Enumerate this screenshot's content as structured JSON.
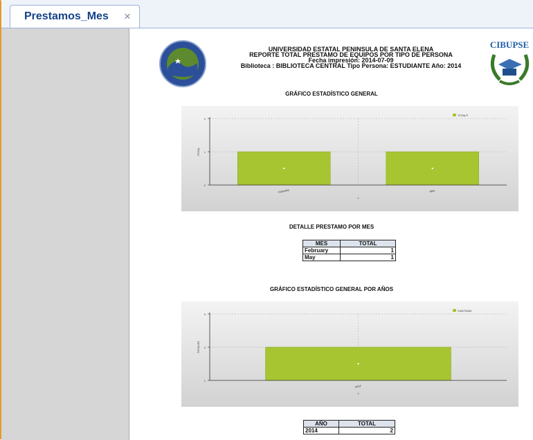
{
  "tab": {
    "label": "Prestamos_Mes",
    "close_glyph": "×",
    "close_icon": "close-icon"
  },
  "report": {
    "logo_right_text": "CIBUPSE",
    "header": {
      "line1": "UNIVERSIDAD ESTATAL PENINSULA DE SANTA ELENA",
      "line2": "REPORTE TOTAL PRESTAMO DE EQUIPOS POR TIPO DE PERSONA",
      "line3": "Fecha impresión: 2014-07-09",
      "line4": "Biblioteca : BIBLIOTECA CENTRAL Tipo Persona: ESTUDIANTE Año: 2014"
    },
    "chart1_title": "GRÁFICO ESTADÍSTICO GENERAL",
    "detail_title": "DETALLE PRESTAMO POR MES",
    "chart2_title": "GRÁFICO ESTADÍSTICO GENERAL POR AÑOS",
    "mes_table": {
      "headers": [
        "MES",
        "TOTAL"
      ],
      "rows": [
        [
          "February",
          "1"
        ],
        [
          "May",
          "1"
        ]
      ]
    },
    "anio_table": {
      "headers": [
        "AÑO",
        "TOTAL"
      ],
      "rows": [
        [
          "2014",
          "2"
        ]
      ]
    }
  },
  "chart_data": [
    {
      "type": "bar",
      "categories": [
        "February",
        "May"
      ],
      "series": [
        {
          "name": "TOTALP",
          "values": [
            1,
            1
          ]
        }
      ],
      "xlabel": "x",
      "ylabel": "TOTAL",
      "ylim": [
        0,
        2
      ],
      "yticks": [
        "0",
        "1",
        "2"
      ],
      "grid": true,
      "legend": "top-right",
      "color": "#a6c531"
    },
    {
      "type": "bar",
      "categories": [
        "2014"
      ],
      "series": [
        {
          "name": "CANTIDAD",
          "values": [
            2
          ]
        }
      ],
      "xlabel": "x",
      "ylabel": "TOTALES",
      "ylim": [
        1,
        3
      ],
      "yticks": [
        "1",
        "2",
        "3"
      ],
      "grid": true,
      "legend": "top-right",
      "color": "#a6c531"
    }
  ]
}
